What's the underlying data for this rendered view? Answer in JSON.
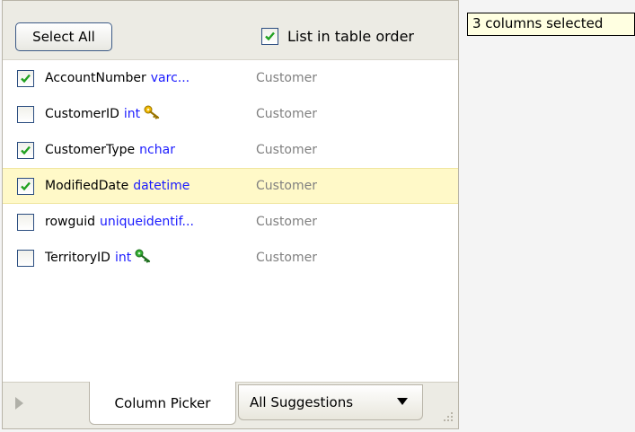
{
  "toolbar": {
    "select_all_label": "Select All",
    "table_order_label": "List in table order",
    "table_order_checked": true
  },
  "columns": [
    {
      "name": "AccountNumber",
      "type": "varc...",
      "table": "Customer",
      "checked": true,
      "key": null
    },
    {
      "name": "CustomerID",
      "type": "int",
      "table": "Customer",
      "checked": false,
      "key": "primary-key-icon"
    },
    {
      "name": "CustomerType",
      "type": "nchar",
      "table": "Customer",
      "checked": true,
      "key": null
    },
    {
      "name": "ModifiedDate",
      "type": "datetime",
      "table": "Customer",
      "checked": true,
      "key": null,
      "highlighted": true
    },
    {
      "name": "rowguid",
      "type": "uniqueidentif...",
      "table": "Customer",
      "checked": false,
      "key": null
    },
    {
      "name": "TerritoryID",
      "type": "int",
      "table": "Customer",
      "checked": false,
      "key": "foreign-key-icon"
    }
  ],
  "tabs": {
    "column_picker": "Column Picker",
    "all_suggestions": "All Suggestions"
  },
  "tooltip": "3 columns selected",
  "colors": {
    "highlight_row": "#fff9c8",
    "type_text": "#1a1aff",
    "table_text": "#808080",
    "primary_key": "#e0a800",
    "foreign_key": "#2aa02a",
    "tooltip_bg": "#ffffe1"
  }
}
